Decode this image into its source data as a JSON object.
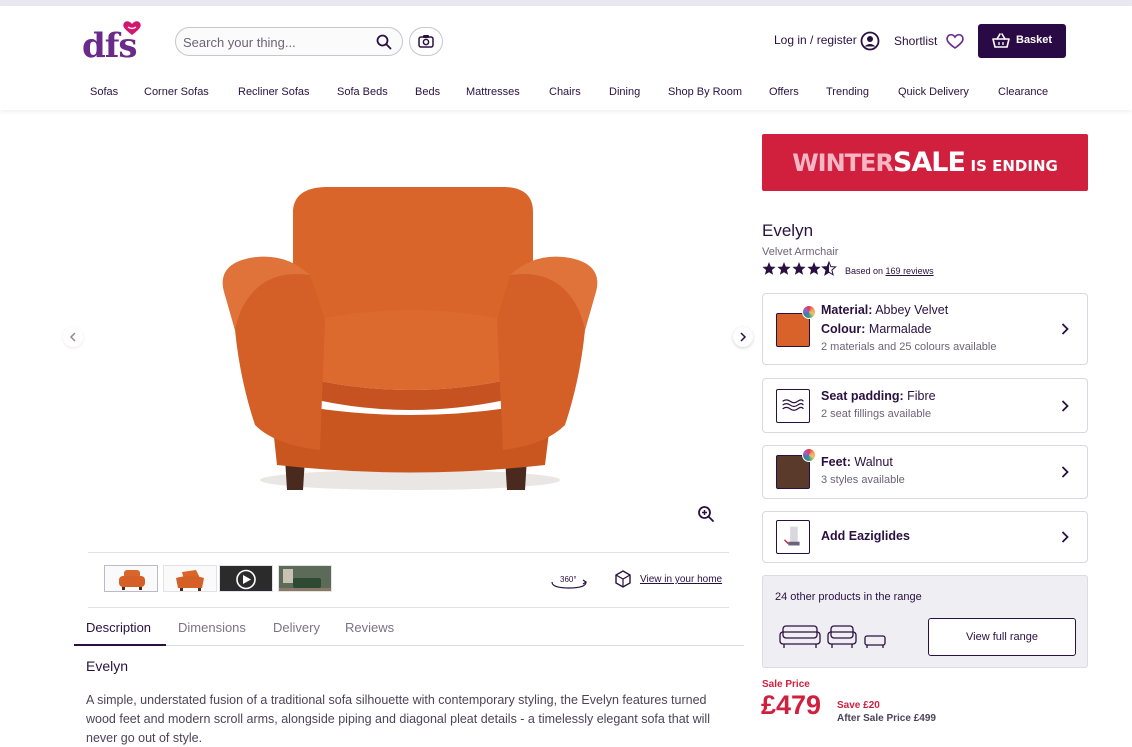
{
  "brand": {
    "logo_text": "dfs",
    "accent": "#6a2a8a",
    "dark": "#2a0a45",
    "sale_red": "#d11f3e"
  },
  "header": {
    "search_placeholder": "Search your thing...",
    "login_label": "Log in / register",
    "shortlist_label": "Shortlist",
    "basket_label": "Basket"
  },
  "nav": {
    "items": [
      "Sofas",
      "Corner Sofas",
      "Recliner Sofas",
      "Sofa Beds",
      "Beds",
      "Mattresses",
      "Chairs",
      "Dining",
      "Shop By Room",
      "Offers",
      "Trending",
      "Quick Delivery",
      "Clearance"
    ]
  },
  "gallery": {
    "view_in_home": "View in your home",
    "label_360": "360°"
  },
  "tabs": [
    "Description",
    "Dimensions",
    "Delivery",
    "Reviews"
  ],
  "description": {
    "title": "Evelyn",
    "body": "A simple, understated fusion of a traditional sofa silhouette with contemporary styling, the Evelyn features turned wood feet and modern scroll arms, alongside piping and diagonal pleat details - a timelessly elegant sofa that will never go out of style."
  },
  "banner": {
    "word1": "WINTER",
    "word2": "SALE",
    "word3": "IS ENDING"
  },
  "product": {
    "name": "Evelyn",
    "subtitle": "Velvet Armchair",
    "rating": 4.5,
    "reviews_prefix": "Based on",
    "reviews_link": "169 reviews"
  },
  "options": {
    "material": {
      "material_label": "Material:",
      "material_value": "Abbey Velvet",
      "colour_label": "Colour:",
      "colour_value": "Marmalade",
      "sub": "2 materials and 25 colours available",
      "swatch_color": "#d9622a"
    },
    "seat": {
      "label": "Seat padding:",
      "value": "Fibre",
      "sub": "2 seat fillings available"
    },
    "feet": {
      "label": "Feet:",
      "value": "Walnut",
      "sub": "3 styles available",
      "swatch_color": "#5a3a2a"
    },
    "eazi": {
      "label": "Add Eaziglides"
    }
  },
  "range": {
    "text": "24 other products in the range",
    "button": "View full range"
  },
  "price": {
    "label": "Sale Price",
    "value": "£479",
    "save": "Save £20",
    "after": "After Sale Price £499"
  }
}
